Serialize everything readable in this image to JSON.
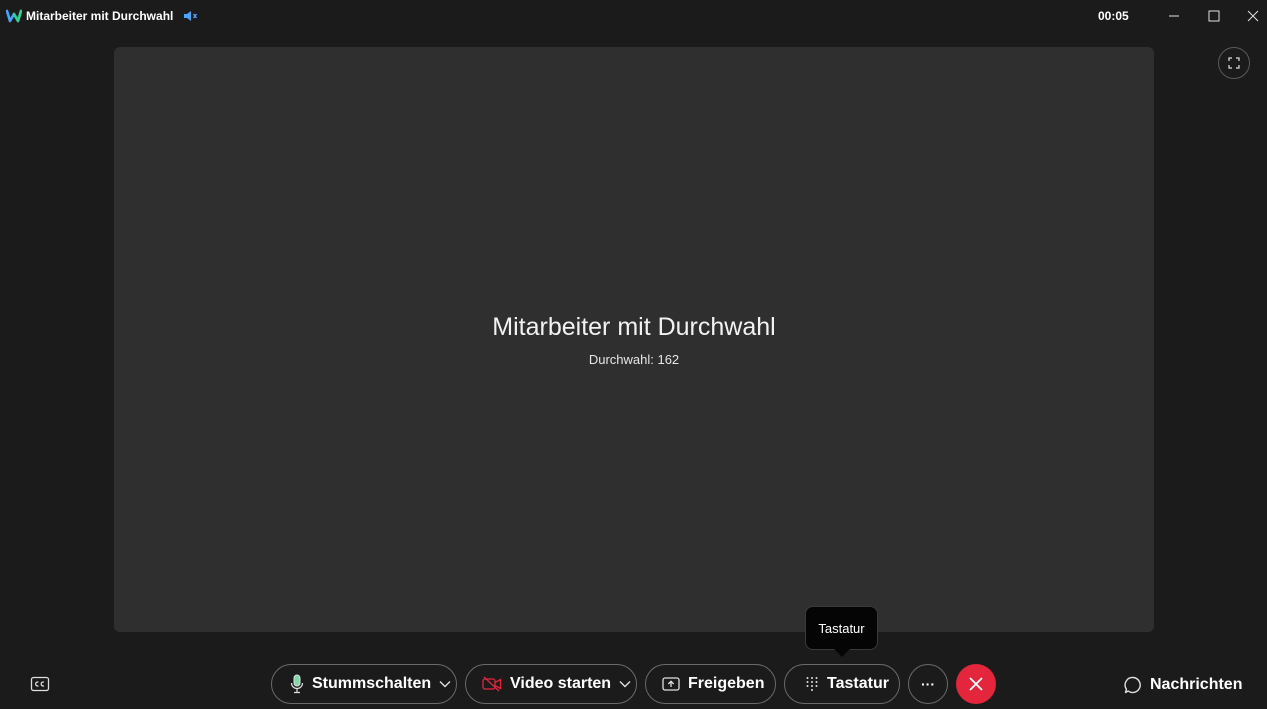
{
  "window": {
    "title": "Mitarbeiter mit Durchwahl",
    "timer": "00:05",
    "icons": {
      "logo": "webex-logo-icon",
      "audio": "speaker-icon",
      "minimize": "minimize-icon",
      "maximize": "maximize-icon",
      "close": "close-icon"
    }
  },
  "stage": {
    "participant_name": "Mitarbeiter mit Durchwahl",
    "extension_line": "Durchwahl: 162",
    "fullscreen_icon": "fullscreen-icon"
  },
  "controls": {
    "captions_icon": "cc-icon",
    "mute_label": "Stummschalten",
    "video_label": "Video starten",
    "share_label": "Freigeben",
    "keypad_label": "Tastatur",
    "more_label": "···",
    "end_call_icon": "close-icon",
    "messages_label": "Nachrichten"
  },
  "tooltip": {
    "text": "Tastatur"
  },
  "colors": {
    "background": "#1b1b1b",
    "stage": "#2f2f2f",
    "end_call": "#e3263b",
    "video_off_icon": "#e3263b",
    "mic_icon": "#7fd9a8",
    "accent_blue": "#4aa3ff"
  }
}
